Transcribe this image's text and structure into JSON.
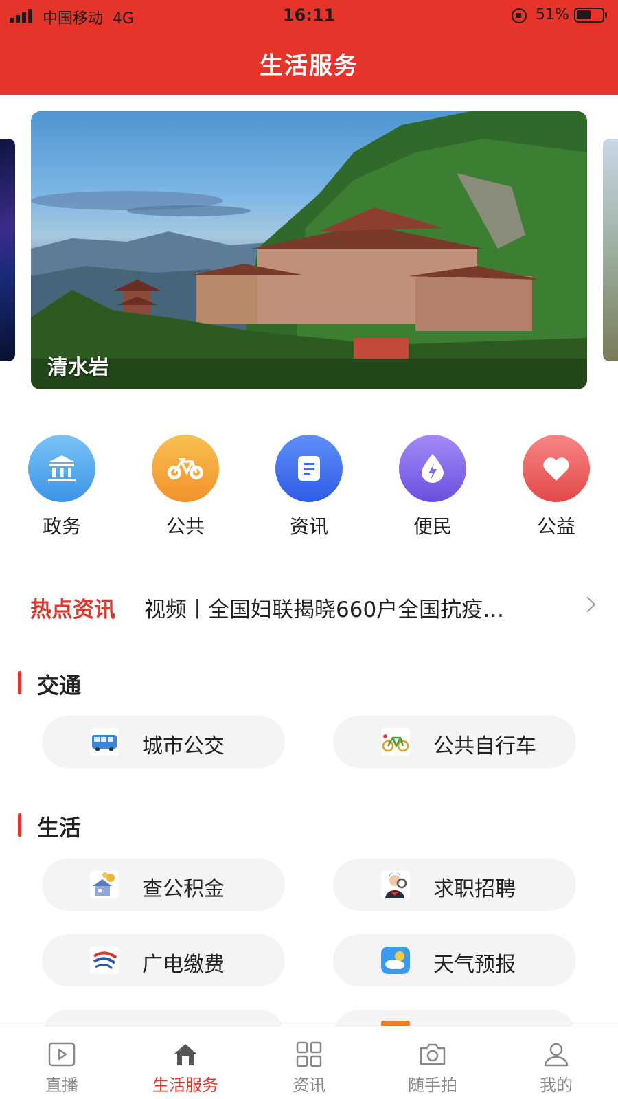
{
  "status_bar": {
    "carrier": "中国移动",
    "network": "4G",
    "time": "16:11",
    "battery": "51%"
  },
  "header": {
    "title": "生活服务",
    "color": "#e6342b"
  },
  "banner": {
    "caption": "清水岩"
  },
  "categories": [
    {
      "label": "政务",
      "icon": "government-building-icon",
      "color": "#4aa8f0"
    },
    {
      "label": "公共",
      "icon": "bicycle-icon",
      "color": "#f5a63a"
    },
    {
      "label": "资讯",
      "icon": "document-icon",
      "color": "#3f6ff0"
    },
    {
      "label": "便民",
      "icon": "water-drop-icon",
      "color": "#8a6af0"
    },
    {
      "label": "公益",
      "icon": "heart-icon",
      "color": "#f06060"
    }
  ],
  "hot_news": {
    "label": "热点资讯",
    "text": "视频丨全国妇联揭晓660户全国抗疫…"
  },
  "sections": [
    {
      "title": "交通",
      "items": [
        {
          "label": "城市公交",
          "icon": "bus-icon"
        },
        {
          "label": "公共自行车",
          "icon": "bicycle-icon"
        }
      ]
    },
    {
      "title": "生活",
      "items": [
        {
          "label": "查公积金",
          "icon": "housing-fund-icon"
        },
        {
          "label": "求职招聘",
          "icon": "job-search-icon"
        },
        {
          "label": "广电缴费",
          "icon": "broadcast-payment-icon"
        },
        {
          "label": "天气预报",
          "icon": "weather-icon"
        }
      ]
    }
  ],
  "bottom_nav": [
    {
      "label": "直播",
      "icon": "play-icon",
      "active": false
    },
    {
      "label": "生活服务",
      "icon": "home-icon",
      "active": true
    },
    {
      "label": "资讯",
      "icon": "grid-icon",
      "active": false
    },
    {
      "label": "随手拍",
      "icon": "camera-icon",
      "active": false
    },
    {
      "label": "我的",
      "icon": "user-icon",
      "active": false
    }
  ]
}
